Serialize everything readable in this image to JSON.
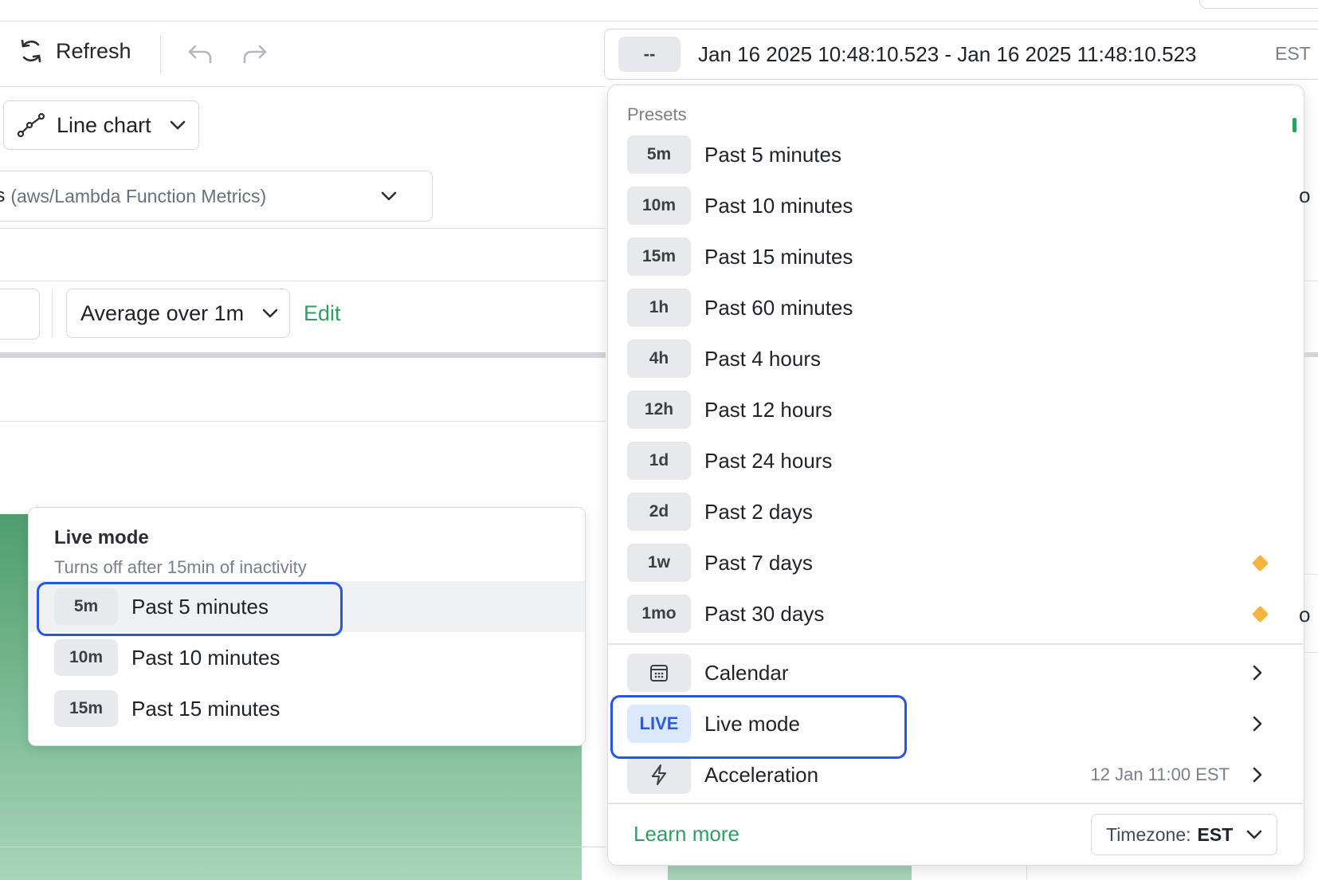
{
  "toolbar": {
    "refresh_label": "Refresh",
    "undo_icon": "undo-icon",
    "redo_icon": "redo-icon"
  },
  "time_range": {
    "chip": "--",
    "text": "Jan 16 2025 10:48:10.523 - Jan 16 2025 11:48:10.523",
    "timezone": "EST"
  },
  "chart_type": {
    "label": "Line chart"
  },
  "metric_select": {
    "prefix": "gs",
    "source": "(aws/Lambda Function Metrics)"
  },
  "aggregation": {
    "label": "Average over 1m",
    "edit_label": "Edit"
  },
  "live_popover": {
    "title": "Live mode",
    "subtitle": "Turns off after 15min of inactivity",
    "items": [
      {
        "chip": "5m",
        "label": "Past 5 minutes"
      },
      {
        "chip": "10m",
        "label": "Past 10 minutes"
      },
      {
        "chip": "15m",
        "label": "Past 15 minutes"
      }
    ]
  },
  "presets": {
    "header": "Presets",
    "items": [
      {
        "chip": "5m",
        "label": "Past 5 minutes"
      },
      {
        "chip": "10m",
        "label": "Past 10 minutes"
      },
      {
        "chip": "15m",
        "label": "Past 15 minutes"
      },
      {
        "chip": "1h",
        "label": "Past 60 minutes"
      },
      {
        "chip": "4h",
        "label": "Past 4 hours"
      },
      {
        "chip": "12h",
        "label": "Past 12 hours"
      },
      {
        "chip": "1d",
        "label": "Past 24 hours"
      },
      {
        "chip": "2d",
        "label": "Past 2 days"
      },
      {
        "chip": "1w",
        "label": "Past 7 days"
      },
      {
        "chip": "1mo",
        "label": "Past 30 days"
      }
    ],
    "calendar_label": "Calendar",
    "live_chip": "LIVE",
    "live_label": "Live mode",
    "acceleration_label": "Acceleration",
    "acceleration_meta": "12 Jan 11:00 EST",
    "learn_more": "Learn more",
    "timezone_label": "Timezone:",
    "timezone_value": "EST"
  },
  "edge_fragments": {
    "right_top": "o",
    "right_mid": "o"
  },
  "colors": {
    "accent_green": "#2f9e63",
    "focus_blue": "#2557e5",
    "premium_diamond": "#f4b63f",
    "live_chip_bg": "#dce8fb"
  }
}
